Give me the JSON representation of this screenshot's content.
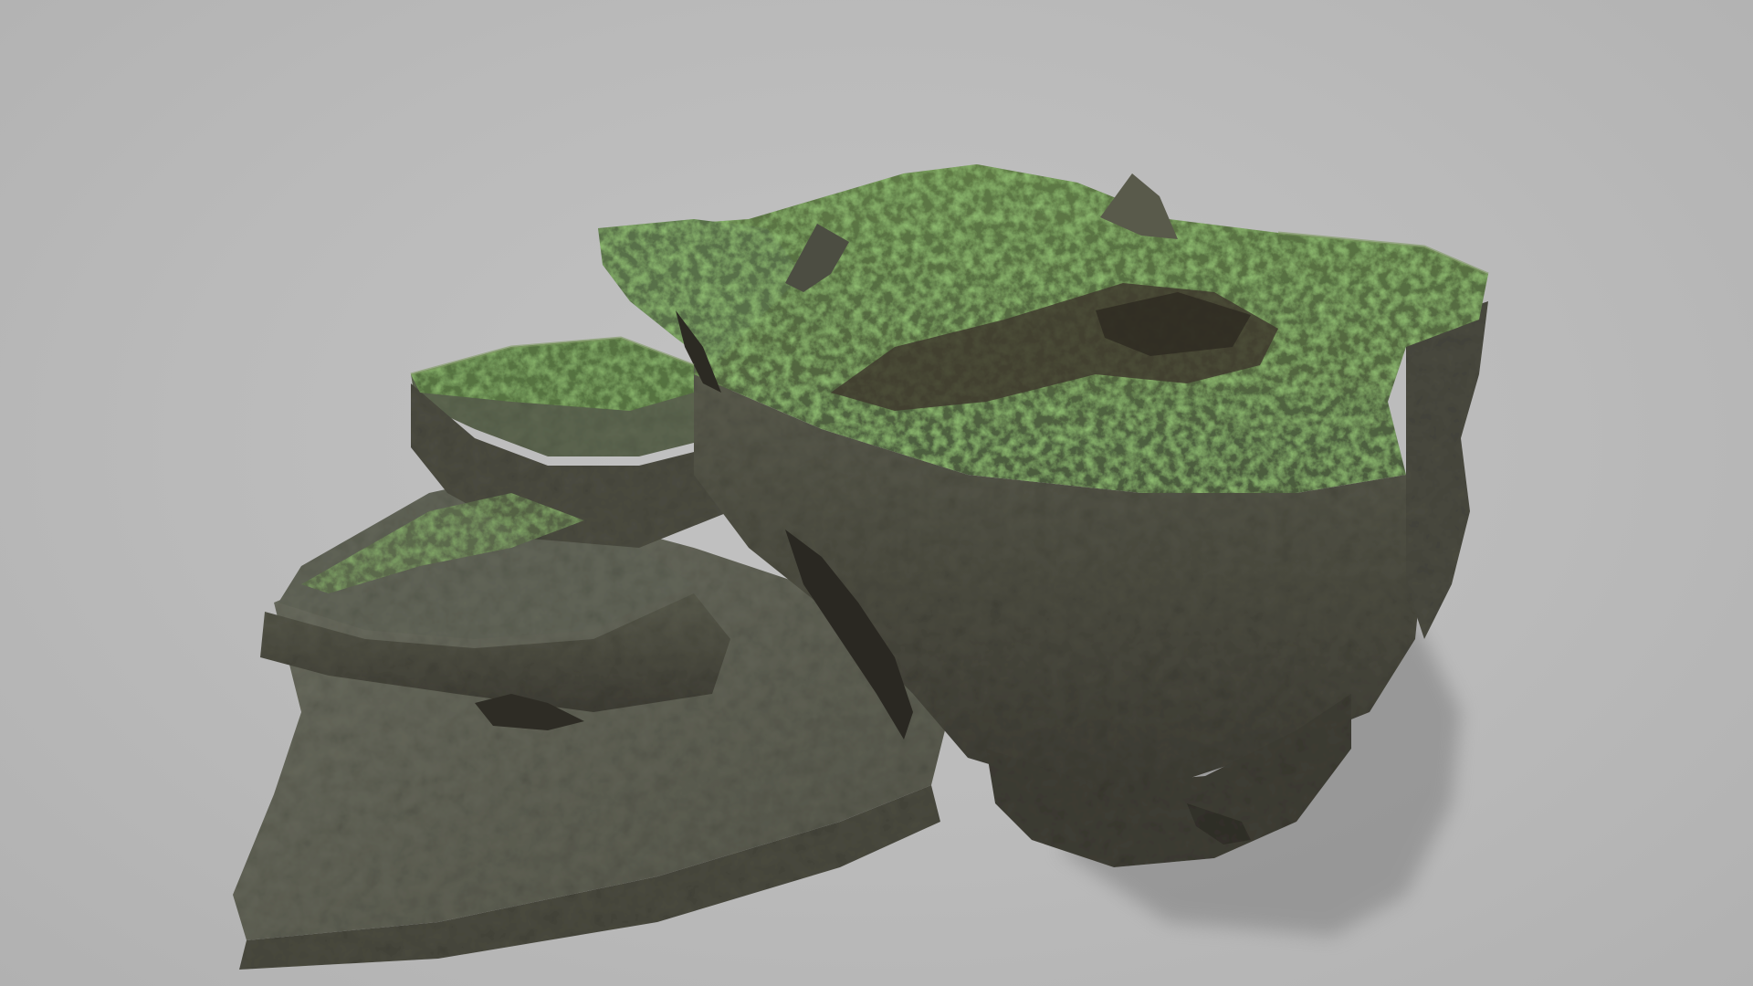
{
  "scene": {
    "subject": "rock-formation",
    "background_color": "#b9b9b9",
    "colors": {
      "moss": "#4f7a35",
      "moss_bright": "#6fa23f",
      "rock_light": "#6b6e5f",
      "rock_mid": "#55574a",
      "rock_dark": "#3d3c33",
      "crevice": "#2a2822",
      "shadow": "#8f8f8f"
    }
  }
}
